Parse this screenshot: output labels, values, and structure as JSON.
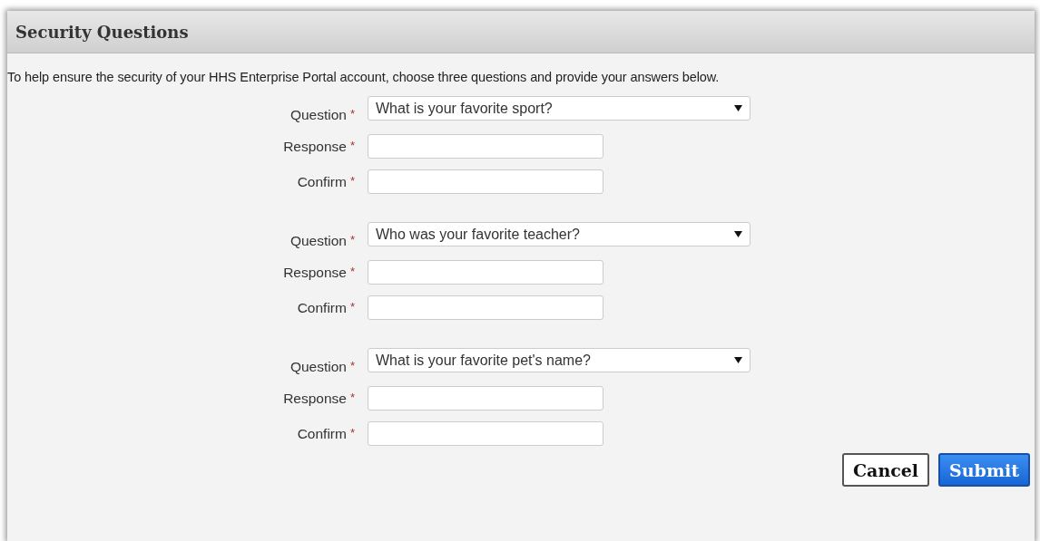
{
  "panel": {
    "title": "Security Questions"
  },
  "intro": "To help ensure the security of your HHS Enterprise Portal account, choose three questions and provide your answers below.",
  "groups": [
    {
      "question": {
        "label": "Question",
        "mark": "*",
        "value": "What is your favorite sport?"
      },
      "response": {
        "label": "Response",
        "mark": "*"
      },
      "confirm": {
        "label": "Confirm",
        "mark": "*"
      }
    },
    {
      "question": {
        "label": "Question",
        "mark": "*",
        "value": "Who was your favorite teacher?"
      },
      "response": {
        "label": "Response",
        "mark": "*"
      },
      "confirm": {
        "label": "Confirm",
        "mark": "*"
      }
    },
    {
      "question": {
        "label": "Question",
        "mark": "*",
        "value": "What is your favorite pet's name?"
      },
      "response": {
        "label": "Response",
        "mark": "*"
      },
      "confirm": {
        "label": "Confirm",
        "mark": "*"
      }
    }
  ],
  "buttons": [
    {
      "label": "Cancel",
      "kind": "secondary"
    },
    {
      "label": "Submit",
      "kind": "primary"
    }
  ]
}
